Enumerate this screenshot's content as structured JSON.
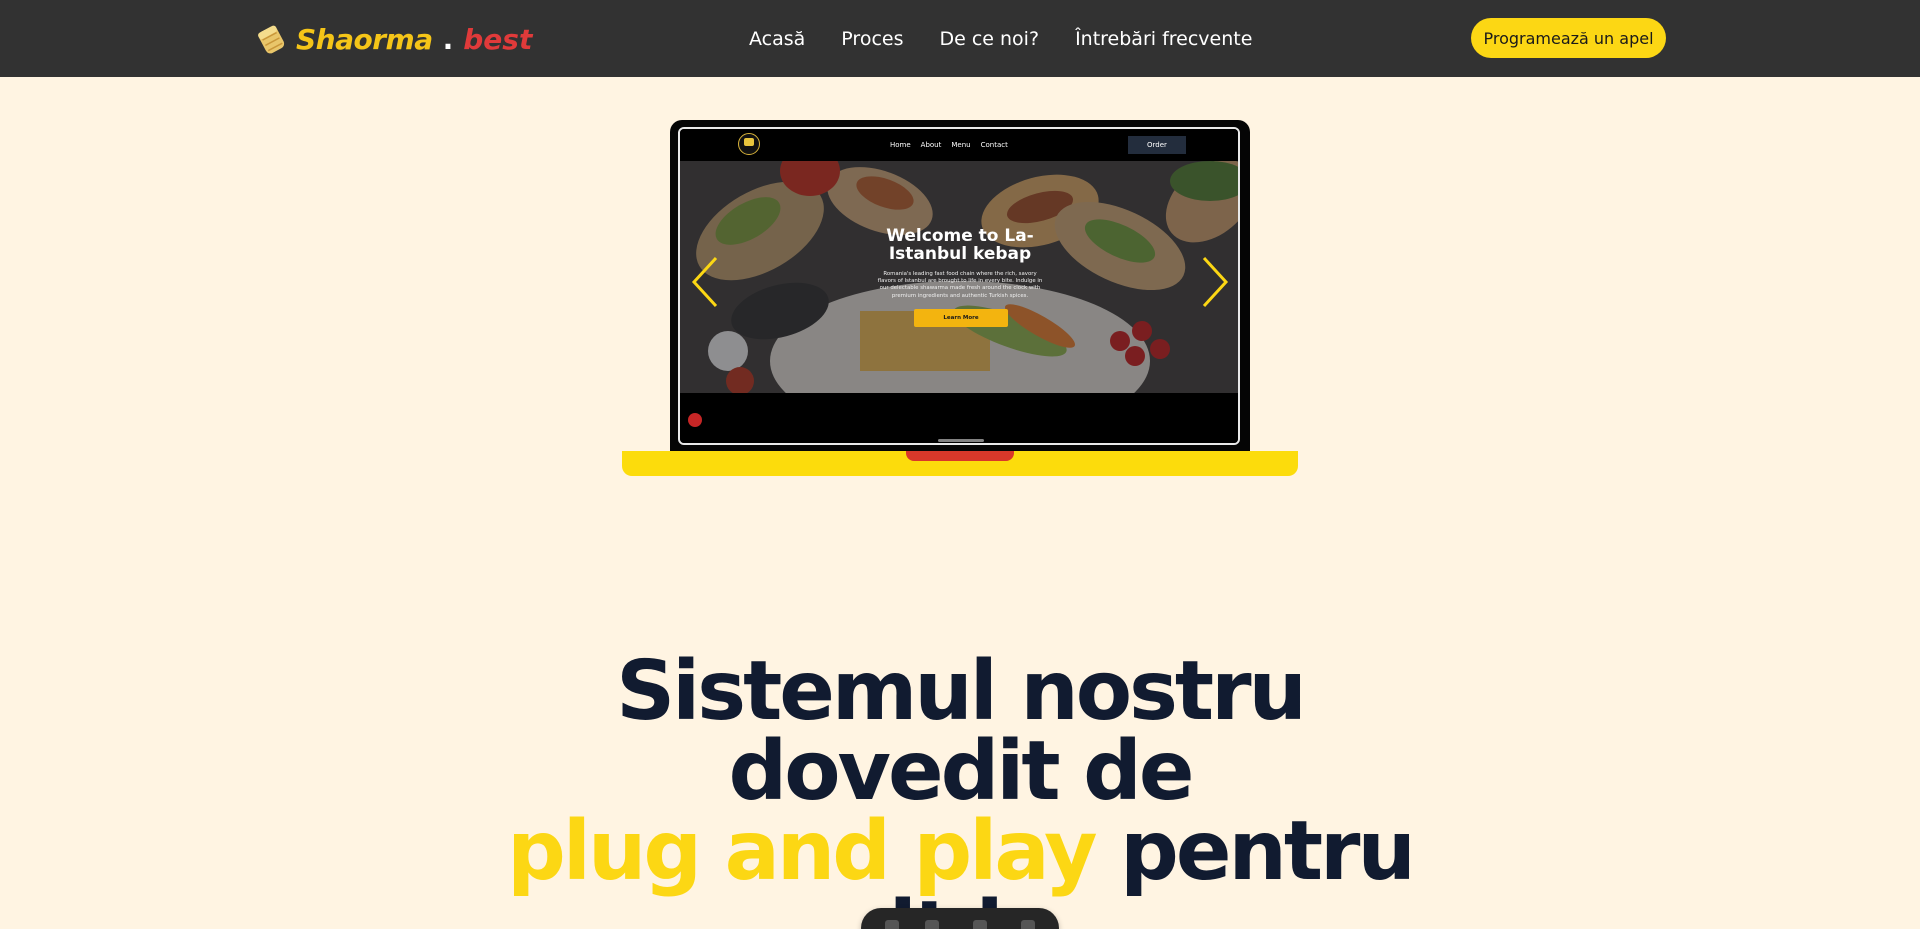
{
  "brand": {
    "name": "Shaorma",
    "dot": ".",
    "tld": "best",
    "icon": "shawarma-wrap-icon",
    "colors": {
      "name": "#f5c518",
      "tld": "#e03a3a"
    }
  },
  "nav": {
    "items": [
      {
        "label": "Acasă"
      },
      {
        "label": "Proces"
      },
      {
        "label": "De ce noi?"
      },
      {
        "label": "Întrebări frecvente"
      }
    ],
    "cta_label": "Programează un apel"
  },
  "mockup": {
    "nav_links": [
      "Home",
      "About",
      "Menu",
      "Contact"
    ],
    "order_label": "Order",
    "hero_title": "Welcome to La-Istanbul kebap",
    "hero_text": "Romania's leading fast food chain where the rich, savory flavors of Istanbul are brought to life in every bite. Indulge in our delectable shawarma made fresh around the clock with premium ingredients and authentic Turkish spices.",
    "learn_more_label": "Learn More",
    "icons": {
      "prev": "chevron-left-icon",
      "next": "chevron-right-icon",
      "logo": "restaurant-logo-icon"
    }
  },
  "headline": {
    "line1": "Sistemul nostru",
    "line2": "dovedit de",
    "highlight": "plug and play",
    "line3_rest": " pentru",
    "line4_partial": "it           b"
  },
  "colors": {
    "background": "#fff4e2",
    "topbar": "#323232",
    "accent_yellow": "#fcd714",
    "accent_red": "#e03a3a",
    "headline": "#111b30"
  }
}
